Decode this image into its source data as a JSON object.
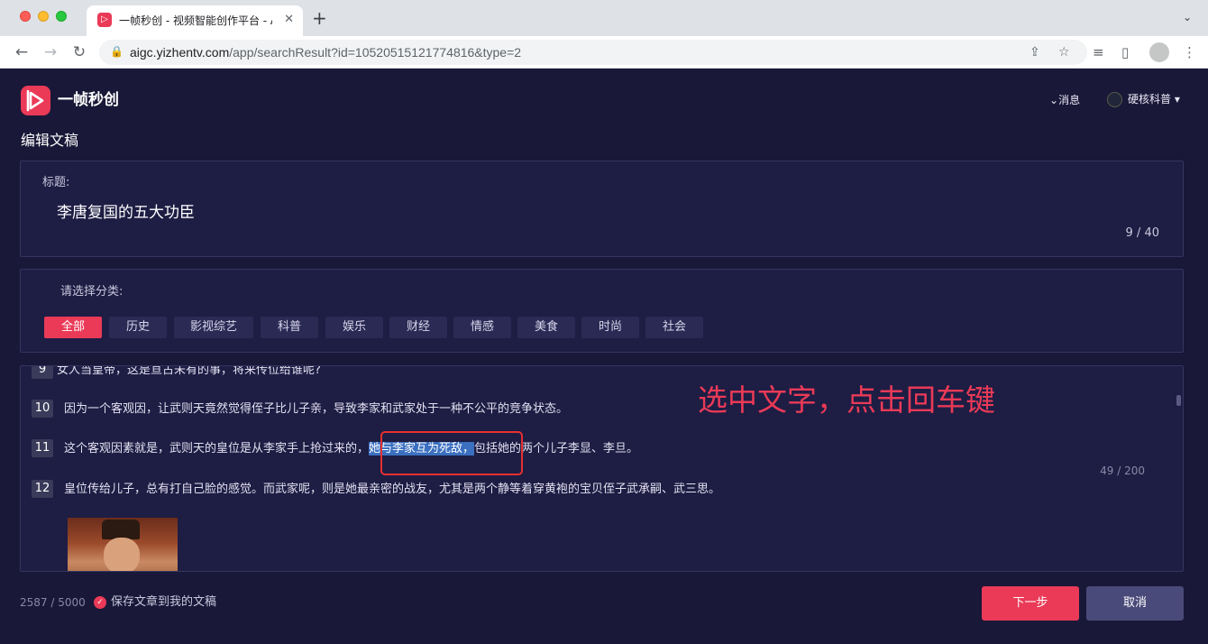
{
  "browser": {
    "tab_title": "一帧秒创 - 视频智能创作平台 - A",
    "tab_close": "✕",
    "new_tab": "+",
    "url_host": "aigc.yizhentv.com",
    "url_path": "/app/searchResult?id=10520515121774816&type=2"
  },
  "header": {
    "brand": "一帧秒创",
    "messages": "消息",
    "username": "硬核科普"
  },
  "page_title": "编辑文稿",
  "title_panel": {
    "label": "标题:",
    "value": "李唐复国的五大功臣",
    "count": "9 / 40"
  },
  "category_panel": {
    "label": "请选择分类:",
    "categories": [
      "全部",
      "历史",
      "影视综艺",
      "科普",
      "娱乐",
      "财经",
      "情感",
      "美食",
      "时尚",
      "社会"
    ],
    "selected": "全部"
  },
  "content": {
    "lines": [
      {
        "num": "9",
        "text": "女人当皇帝，这是亘古未有的事，将来传位给谁呢?"
      },
      {
        "num": "10",
        "text": "因为一个客观因，让武则天竟然觉得侄子比儿子亲，导致李家和武家处于一种不公平的竞争状态。"
      },
      {
        "num": "11",
        "text_before": "这个客观因素就是，武则天的皇位是从李家手上抢过来的，",
        "text_selected": "她与李家互为死敌，",
        "text_after": "包括她的两个儿子李显、李旦。"
      },
      {
        "num": "12",
        "text": "皇位传给儿子，总有打自己脸的感觉。而武家呢，则是她最亲密的战友，尤其是两个静等着穿黄袍的宝贝侄子武承嗣、武三思。"
      }
    ],
    "line_count": "49 / 200"
  },
  "annotation": "选中文字，点击回车键",
  "footer": {
    "word_count": "2587 / 5000",
    "save_label": "保存文章到我的文稿",
    "next_button": "下一步",
    "cancel_button": "取消"
  },
  "colors": {
    "accent": "#ea3a57",
    "background": "#1a1838",
    "panel": "#1e1d44",
    "selection": "#3b70c0",
    "annotation_box": "#e63030"
  }
}
